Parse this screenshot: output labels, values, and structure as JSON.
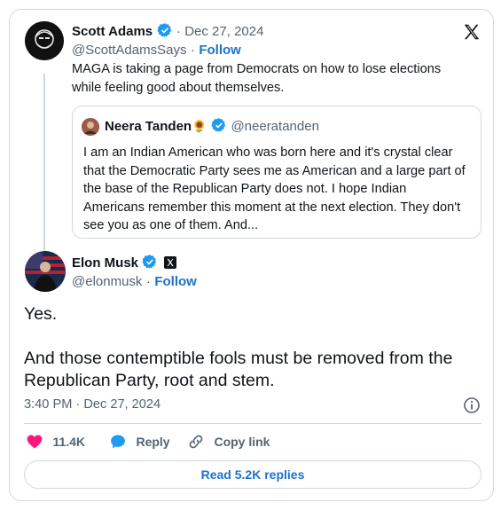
{
  "colors": {
    "accent": "#1d9bf0",
    "link": "#1d72c8",
    "like": "#f91880",
    "border": "#cfd9de",
    "muted": "#536471"
  },
  "parent_post": {
    "author_name": "Scott Adams",
    "separator_date": "· Dec 27, 2024",
    "handle": "@ScottAdamsSays",
    "dot": "·",
    "follow_label": "Follow",
    "text_line1": "MAGA is taking a page from Democrats on how to lose elections",
    "text_line2": "while feeling good about themselves."
  },
  "quoted_post": {
    "author_name": "Neera Tanden",
    "emoji": "🌻",
    "handle": "@neeratanden",
    "lines": [
      "I am an Indian American who was born here and it's crystal clear",
      "that the Democratic Party sees me as American and a large part of",
      "the base of the Republican Party does not. I hope Indian",
      "Americans remember this moment at the next election. They don't",
      "see you as one of them. And..."
    ]
  },
  "main_post": {
    "author_name": "Elon Musk",
    "handle": "@elonmusk",
    "dot": "·",
    "follow_label": "Follow",
    "text_line1": "Yes.",
    "text_line2": "And those contemptible fools must be removed from the",
    "text_line3": "Republican Party, root and stem.",
    "timestamp": "3:40 PM · Dec 27, 2024"
  },
  "actions": {
    "likes": "11.4K",
    "reply_label": "Reply",
    "copy_label": "Copy link"
  },
  "read_replies_label": "Read 5.2K replies",
  "icons": [
    "x-logo-icon",
    "verified-icon",
    "heart-icon",
    "reply-icon",
    "link-icon",
    "info-icon",
    "x-affiliate-badge-icon"
  ]
}
